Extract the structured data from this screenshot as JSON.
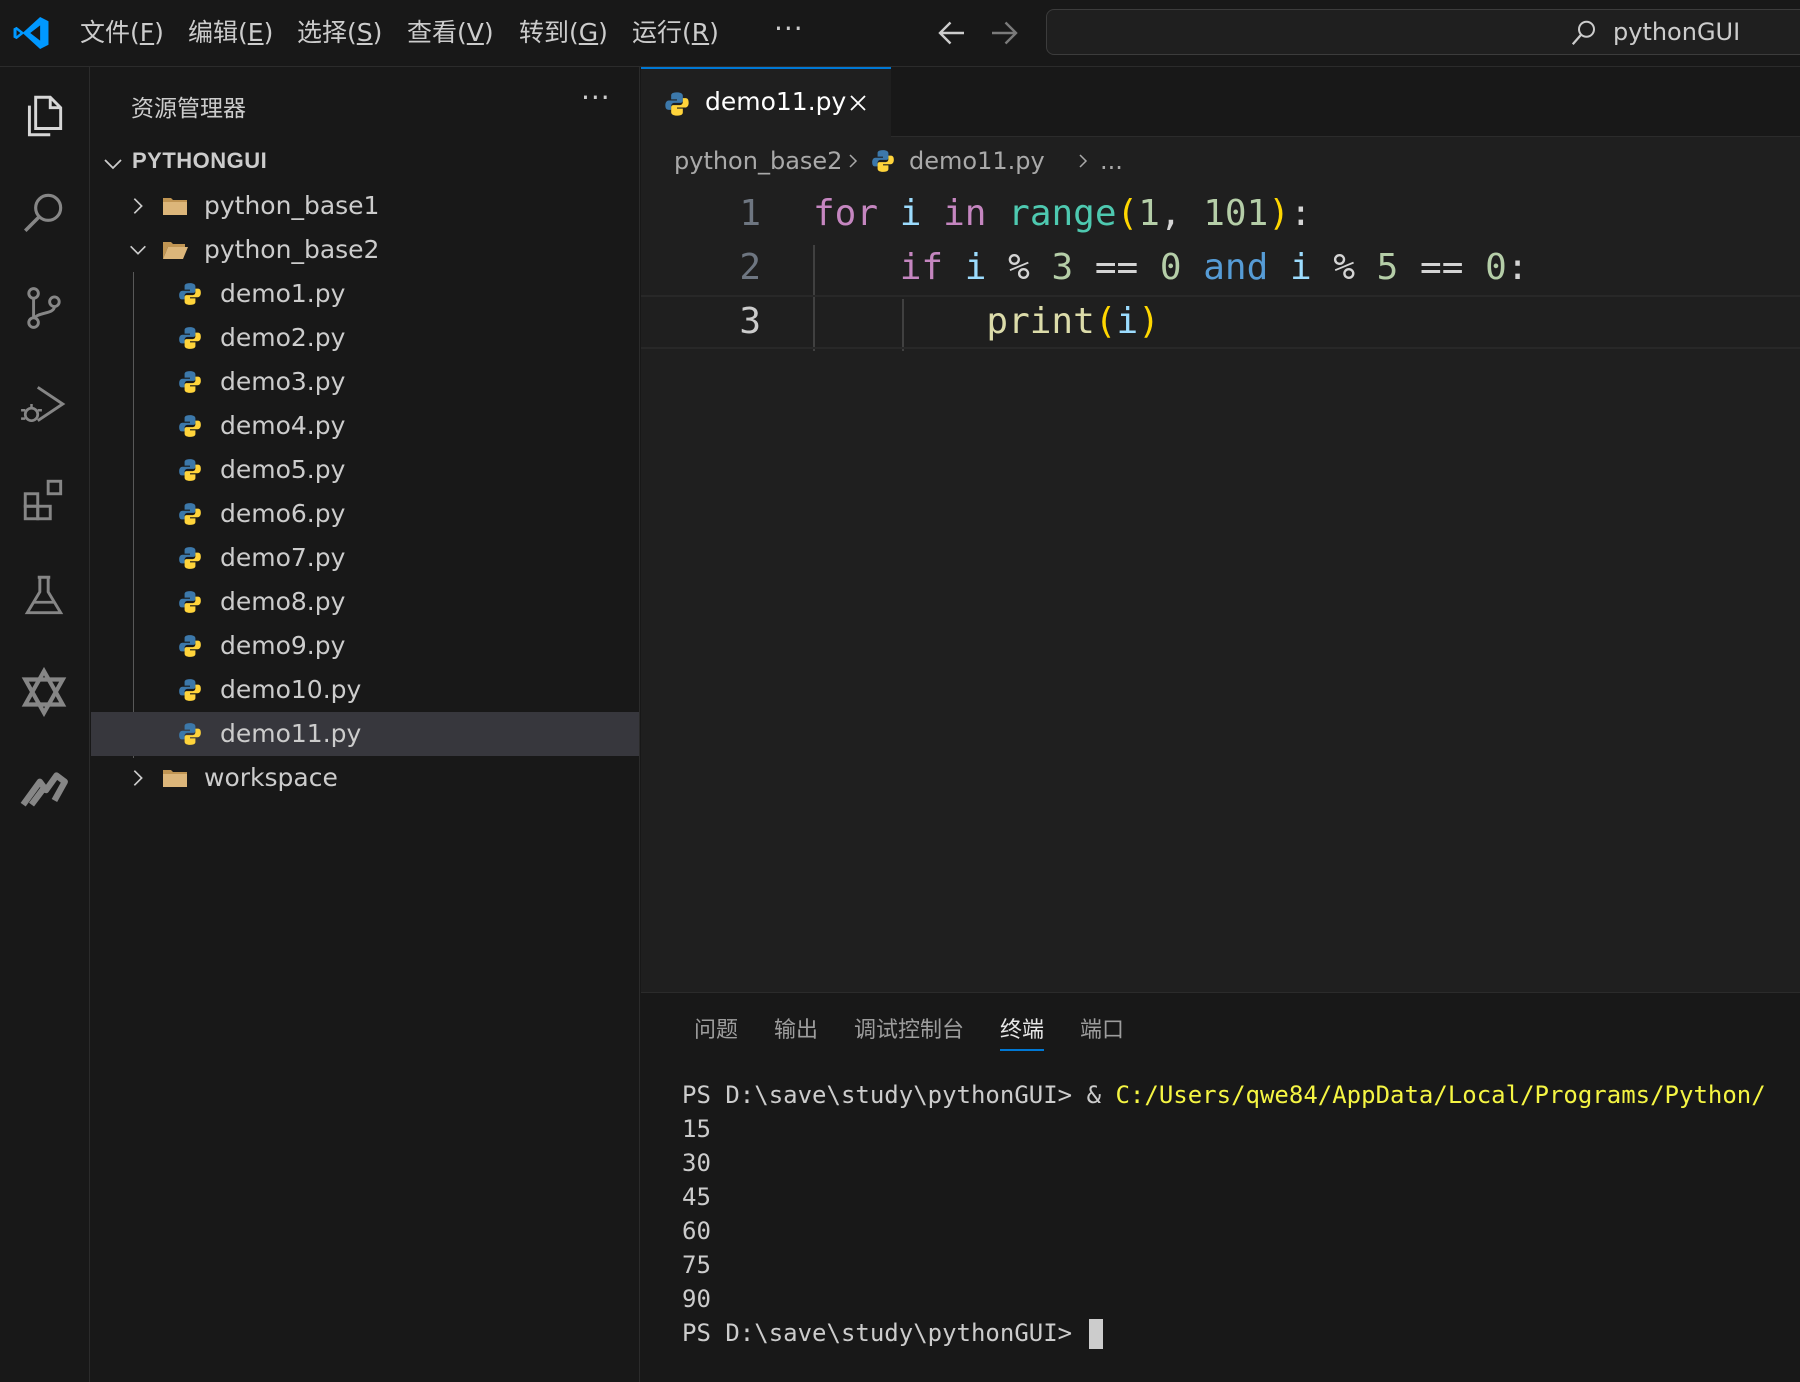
{
  "titlebar": {
    "menu": [
      {
        "label": "文件(",
        "key": "F",
        "end": ")"
      },
      {
        "label": "编辑(",
        "key": "E",
        "end": ")"
      },
      {
        "label": "选择(",
        "key": "S",
        "end": ")"
      },
      {
        "label": "查看(",
        "key": "V",
        "end": ")"
      },
      {
        "label": "转到(",
        "key": "G",
        "end": ")"
      },
      {
        "label": "运行(",
        "key": "R",
        "end": ")"
      }
    ],
    "more": "···",
    "search_text": "pythonGUI"
  },
  "activitybar": {
    "icons": [
      "explorer-icon",
      "search-icon",
      "source-control-icon",
      "run-debug-icon",
      "extensions-icon",
      "testing-icon",
      "ai-assistant-icon",
      "marscode-icon"
    ]
  },
  "sidebar": {
    "title": "资源管理器",
    "more": "···",
    "root": "PYTHONGUI",
    "tree": [
      {
        "label": "python_base1",
        "type": "folder"
      },
      {
        "label": "python_base2",
        "type": "folder-open"
      },
      {
        "label": "demo1.py",
        "type": "py"
      },
      {
        "label": "demo2.py",
        "type": "py"
      },
      {
        "label": "demo3.py",
        "type": "py"
      },
      {
        "label": "demo4.py",
        "type": "py"
      },
      {
        "label": "demo5.py",
        "type": "py"
      },
      {
        "label": "demo6.py",
        "type": "py"
      },
      {
        "label": "demo7.py",
        "type": "py"
      },
      {
        "label": "demo8.py",
        "type": "py"
      },
      {
        "label": "demo9.py",
        "type": "py"
      },
      {
        "label": "demo10.py",
        "type": "py"
      },
      {
        "label": "demo11.py",
        "type": "py",
        "selected": true
      },
      {
        "label": "workspace",
        "type": "folder"
      }
    ]
  },
  "editor": {
    "tab_label": "demo11.py",
    "breadcrumb": {
      "folder": "python_base2",
      "file": "demo11.py",
      "more": "..."
    },
    "lines": [
      {
        "num": "1",
        "tokens": [
          [
            "kw",
            "for"
          ],
          [
            "op",
            " "
          ],
          [
            "var",
            "i"
          ],
          [
            "op",
            " "
          ],
          [
            "kw",
            "in"
          ],
          [
            "op",
            " "
          ],
          [
            "fn",
            "range"
          ],
          [
            "par",
            "("
          ],
          [
            "num",
            "1"
          ],
          [
            "op",
            ", "
          ],
          [
            "num",
            "101"
          ],
          [
            "par",
            ")"
          ],
          [
            "op",
            ":"
          ]
        ]
      },
      {
        "num": "2",
        "tokens": [
          [
            "op",
            "    "
          ],
          [
            "kw",
            "if"
          ],
          [
            "op",
            " "
          ],
          [
            "var",
            "i"
          ],
          [
            "op",
            " % "
          ],
          [
            "num",
            "3"
          ],
          [
            "op",
            " == "
          ],
          [
            "num",
            "0"
          ],
          [
            "op",
            " "
          ],
          [
            "andk",
            "and"
          ],
          [
            "op",
            " "
          ],
          [
            "var",
            "i"
          ],
          [
            "op",
            " % "
          ],
          [
            "num",
            "5"
          ],
          [
            "op",
            " == "
          ],
          [
            "num",
            "0"
          ],
          [
            "op",
            ":"
          ]
        ]
      },
      {
        "num": "3",
        "tokens": [
          [
            "op",
            "        "
          ],
          [
            "fn2",
            "print"
          ],
          [
            "par",
            "("
          ],
          [
            "var",
            "i"
          ],
          [
            "par",
            ")"
          ]
        ]
      }
    ]
  },
  "panel": {
    "tabs": [
      "问题",
      "输出",
      "调试控制台",
      "终端",
      "端口"
    ],
    "active_tab": "终端",
    "terminal": {
      "prompt": "PS D:\\save\\study\\pythonGUI> ",
      "command_prefix": "& ",
      "command": "C:/Users/qwe84/AppData/Local/Programs/Python/",
      "output": [
        "15",
        "30",
        "45",
        "60",
        "75",
        "90"
      ],
      "final_prompt": "PS D:\\save\\study\\pythonGUI> "
    }
  },
  "colors": {
    "accent": "#0078d4",
    "keyword": "#c586c0",
    "variable": "#9cdcfe",
    "builtin": "#4ec9b0",
    "function": "#dcdcaa",
    "number": "#b5cea8",
    "bracket": "#ffd700",
    "and_keyword": "#569cd6",
    "terminal_command": "#f5f543"
  }
}
